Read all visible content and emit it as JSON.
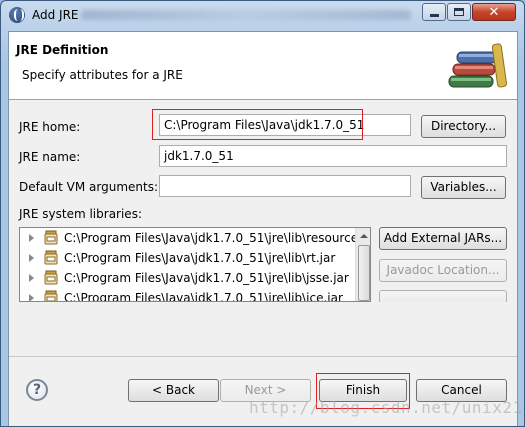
{
  "window": {
    "title": "Add JRE",
    "minimize_glyph": "—",
    "close_glyph": "✕"
  },
  "header": {
    "title": "JRE Definition",
    "description": "Specify attributes for a JRE",
    "icon": "books-library-icon"
  },
  "form": {
    "jre_home": {
      "label": "JRE home:",
      "value": "C:\\Program Files\\Java\\jdk1.7.0_51",
      "browse_label": "Directory..."
    },
    "jre_name": {
      "label": "JRE name:",
      "value": "jdk1.7.0_51"
    },
    "vm_args": {
      "label": "Default VM arguments:",
      "value": "",
      "variables_label": "Variables..."
    },
    "libraries": {
      "label": "JRE system libraries:",
      "items": [
        "C:\\Program Files\\Java\\jdk1.7.0_51\\jre\\lib\\resource",
        "C:\\Program Files\\Java\\jdk1.7.0_51\\jre\\lib\\rt.jar",
        "C:\\Program Files\\Java\\jdk1.7.0_51\\jre\\lib\\jsse.jar",
        "C:\\Program Files\\Java\\jdk1.7.0_51\\jre\\lib\\jce.jar"
      ],
      "buttons": {
        "add_external": "Add External JARs...",
        "javadoc": "Javadoc Location..."
      }
    }
  },
  "footer": {
    "help_glyph": "?",
    "back_label": "< Back",
    "next_label": "Next >",
    "finish_label": "Finish",
    "cancel_label": "Cancel"
  },
  "watermark": "http://blog.csdn.net/unix21",
  "colors": {
    "highlight": "#e02020",
    "titlebar": "#aac6e4"
  }
}
